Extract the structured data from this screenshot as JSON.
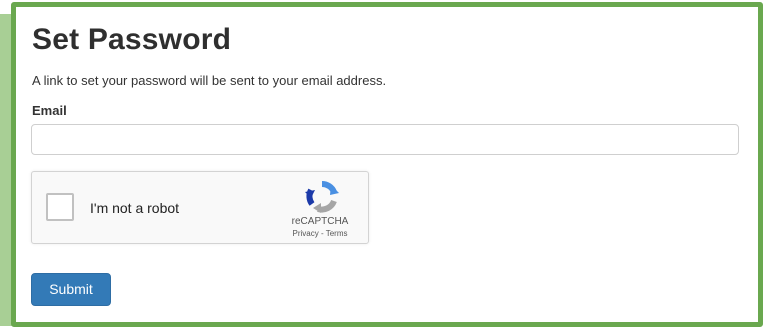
{
  "form": {
    "title": "Set Password",
    "description": "A link to set your password will be sent to your email address.",
    "email_label": "Email",
    "email_value": "",
    "email_placeholder": "",
    "submit_label": "Submit"
  },
  "captcha": {
    "checkbox_label": "I'm not a robot",
    "brand": "reCAPTCHA",
    "privacy_link": "Privacy",
    "separator": " - ",
    "terms_link": "Terms",
    "logo_icon": "recaptcha-logo-icon"
  },
  "colors": {
    "frame_border": "#6aa84f",
    "side_bar": "#a8cf95",
    "submit_button": "#337ab7",
    "recaptcha_blue": "#4a90e2",
    "recaptcha_gray": "#a6a6a6"
  }
}
